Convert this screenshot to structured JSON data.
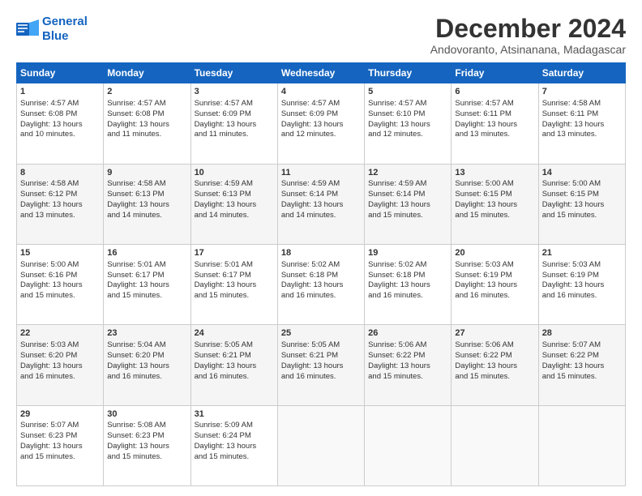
{
  "logo": {
    "line1": "General",
    "line2": "Blue"
  },
  "title": "December 2024",
  "location": "Andovoranto, Atsinanana, Madagascar",
  "days_of_week": [
    "Sunday",
    "Monday",
    "Tuesday",
    "Wednesday",
    "Thursday",
    "Friday",
    "Saturday"
  ],
  "weeks": [
    [
      {
        "day": "1",
        "sunrise": "4:57 AM",
        "sunset": "6:08 PM",
        "daylight": "13 hours and 10 minutes."
      },
      {
        "day": "2",
        "sunrise": "4:57 AM",
        "sunset": "6:08 PM",
        "daylight": "13 hours and 11 minutes."
      },
      {
        "day": "3",
        "sunrise": "4:57 AM",
        "sunset": "6:09 PM",
        "daylight": "13 hours and 11 minutes."
      },
      {
        "day": "4",
        "sunrise": "4:57 AM",
        "sunset": "6:09 PM",
        "daylight": "13 hours and 12 minutes."
      },
      {
        "day": "5",
        "sunrise": "4:57 AM",
        "sunset": "6:10 PM",
        "daylight": "13 hours and 12 minutes."
      },
      {
        "day": "6",
        "sunrise": "4:57 AM",
        "sunset": "6:11 PM",
        "daylight": "13 hours and 13 minutes."
      },
      {
        "day": "7",
        "sunrise": "4:58 AM",
        "sunset": "6:11 PM",
        "daylight": "13 hours and 13 minutes."
      }
    ],
    [
      {
        "day": "8",
        "sunrise": "4:58 AM",
        "sunset": "6:12 PM",
        "daylight": "13 hours and 13 minutes."
      },
      {
        "day": "9",
        "sunrise": "4:58 AM",
        "sunset": "6:13 PM",
        "daylight": "13 hours and 14 minutes."
      },
      {
        "day": "10",
        "sunrise": "4:59 AM",
        "sunset": "6:13 PM",
        "daylight": "13 hours and 14 minutes."
      },
      {
        "day": "11",
        "sunrise": "4:59 AM",
        "sunset": "6:14 PM",
        "daylight": "13 hours and 14 minutes."
      },
      {
        "day": "12",
        "sunrise": "4:59 AM",
        "sunset": "6:14 PM",
        "daylight": "13 hours and 15 minutes."
      },
      {
        "day": "13",
        "sunrise": "5:00 AM",
        "sunset": "6:15 PM",
        "daylight": "13 hours and 15 minutes."
      },
      {
        "day": "14",
        "sunrise": "5:00 AM",
        "sunset": "6:15 PM",
        "daylight": "13 hours and 15 minutes."
      }
    ],
    [
      {
        "day": "15",
        "sunrise": "5:00 AM",
        "sunset": "6:16 PM",
        "daylight": "13 hours and 15 minutes."
      },
      {
        "day": "16",
        "sunrise": "5:01 AM",
        "sunset": "6:17 PM",
        "daylight": "13 hours and 15 minutes."
      },
      {
        "day": "17",
        "sunrise": "5:01 AM",
        "sunset": "6:17 PM",
        "daylight": "13 hours and 15 minutes."
      },
      {
        "day": "18",
        "sunrise": "5:02 AM",
        "sunset": "6:18 PM",
        "daylight": "13 hours and 16 minutes."
      },
      {
        "day": "19",
        "sunrise": "5:02 AM",
        "sunset": "6:18 PM",
        "daylight": "13 hours and 16 minutes."
      },
      {
        "day": "20",
        "sunrise": "5:03 AM",
        "sunset": "6:19 PM",
        "daylight": "13 hours and 16 minutes."
      },
      {
        "day": "21",
        "sunrise": "5:03 AM",
        "sunset": "6:19 PM",
        "daylight": "13 hours and 16 minutes."
      }
    ],
    [
      {
        "day": "22",
        "sunrise": "5:03 AM",
        "sunset": "6:20 PM",
        "daylight": "13 hours and 16 minutes."
      },
      {
        "day": "23",
        "sunrise": "5:04 AM",
        "sunset": "6:20 PM",
        "daylight": "13 hours and 16 minutes."
      },
      {
        "day": "24",
        "sunrise": "5:05 AM",
        "sunset": "6:21 PM",
        "daylight": "13 hours and 16 minutes."
      },
      {
        "day": "25",
        "sunrise": "5:05 AM",
        "sunset": "6:21 PM",
        "daylight": "13 hours and 16 minutes."
      },
      {
        "day": "26",
        "sunrise": "5:06 AM",
        "sunset": "6:22 PM",
        "daylight": "13 hours and 15 minutes."
      },
      {
        "day": "27",
        "sunrise": "5:06 AM",
        "sunset": "6:22 PM",
        "daylight": "13 hours and 15 minutes."
      },
      {
        "day": "28",
        "sunrise": "5:07 AM",
        "sunset": "6:22 PM",
        "daylight": "13 hours and 15 minutes."
      }
    ],
    [
      {
        "day": "29",
        "sunrise": "5:07 AM",
        "sunset": "6:23 PM",
        "daylight": "13 hours and 15 minutes."
      },
      {
        "day": "30",
        "sunrise": "5:08 AM",
        "sunset": "6:23 PM",
        "daylight": "13 hours and 15 minutes."
      },
      {
        "day": "31",
        "sunrise": "5:09 AM",
        "sunset": "6:24 PM",
        "daylight": "13 hours and 15 minutes."
      },
      null,
      null,
      null,
      null
    ]
  ],
  "labels": {
    "sunrise": "Sunrise:",
    "sunset": "Sunset:",
    "daylight": "Daylight:"
  }
}
